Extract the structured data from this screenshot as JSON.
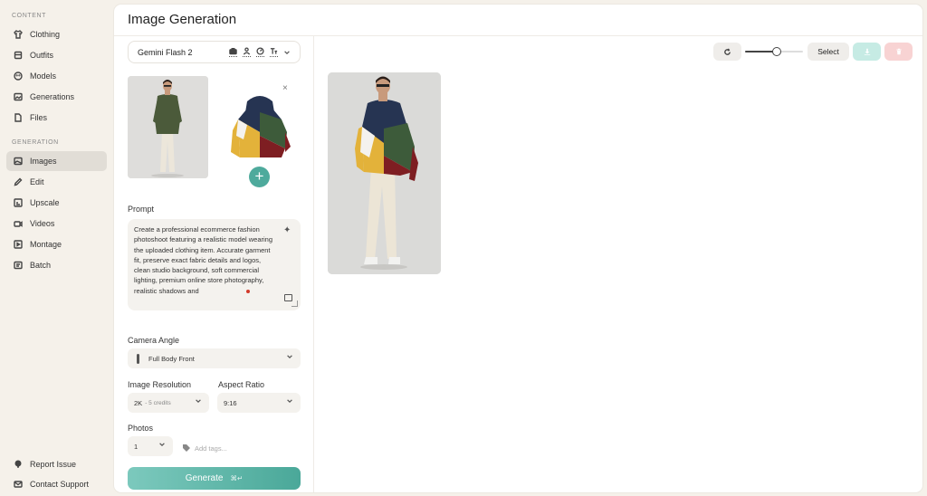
{
  "sidebar": {
    "content_label": "CONTENT",
    "generation_label": "GENERATION",
    "content_items": [
      {
        "label": "Clothing",
        "icon": "shirt-icon"
      },
      {
        "label": "Outfits",
        "icon": "outfit-icon"
      },
      {
        "label": "Models",
        "icon": "face-icon"
      },
      {
        "label": "Generations",
        "icon": "gallery-icon"
      },
      {
        "label": "Files",
        "icon": "file-icon"
      }
    ],
    "generation_items": [
      {
        "label": "Images",
        "icon": "image-icon",
        "active": true
      },
      {
        "label": "Edit",
        "icon": "pencil-icon"
      },
      {
        "label": "Upscale",
        "icon": "upscale-icon"
      },
      {
        "label": "Videos",
        "icon": "video-icon"
      },
      {
        "label": "Montage",
        "icon": "play-icon"
      },
      {
        "label": "Batch",
        "icon": "batch-icon"
      }
    ],
    "footer_items": [
      {
        "label": "Report Issue",
        "icon": "lightbulb-icon"
      },
      {
        "label": "Contact Support",
        "icon": "mail-icon"
      }
    ]
  },
  "header": {
    "title": "Image Generation"
  },
  "panel": {
    "model": "Gemini Flash 2",
    "prompt_label": "Prompt",
    "prompt_text": "Create a professional ecommerce fashion photoshoot featuring a realistic model wearing the uploaded clothing item. Accurate garment fit, preserve exact fabric details and logos, clean studio background, soft commercial lighting, premium online store photography, realistic shadows and",
    "camera_angle_label": "Camera Angle",
    "camera_angle_value": "Full Body Front",
    "resolution_label": "Image Resolution",
    "resolution_value": "2K",
    "resolution_sub": "- 5 credits",
    "aspect_label": "Aspect Ratio",
    "aspect_value": "9:16",
    "photos_label": "Photos",
    "photos_value": "1",
    "tags_placeholder": "Add tags...",
    "remove_symbol": "×",
    "add_symbol": "+",
    "generate_label": "Generate",
    "generate_shortcut": "⌘↵"
  },
  "toolbar": {
    "select_label": "Select",
    "zoom_level": 0.55
  },
  "colors": {
    "accent": "#4eaa9c",
    "background": "#f5f1ea",
    "active_nav": "#e1ddd6"
  }
}
